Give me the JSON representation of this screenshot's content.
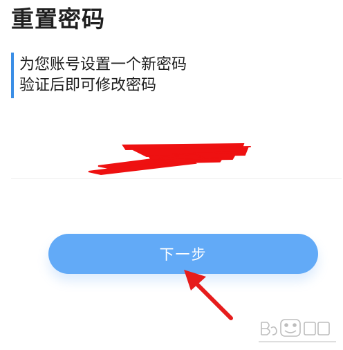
{
  "header": {
    "title": "重置密码"
  },
  "info": {
    "line1": "为您账号设置一个新密码",
    "line2": "验证后即可修改密码"
  },
  "account": {
    "value_redacted": true
  },
  "actions": {
    "next_label": "下一步"
  },
  "colors": {
    "accent_bar": "#3a8ee6",
    "button_bg": "#62aaf7",
    "button_text": "#ffffff",
    "annotation_red": "#e61c1c"
  },
  "watermark": {
    "icon": "baidu-jingyan-logo-icon",
    "text": "Bai 经验",
    "url": "jingyan.baidu.com"
  }
}
